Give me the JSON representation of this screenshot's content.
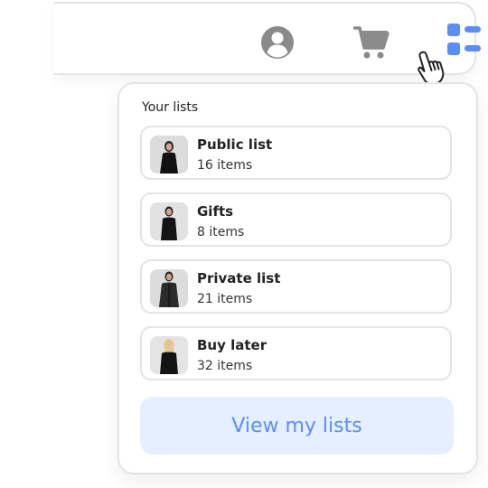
{
  "header": {
    "icons": [
      "profile-icon",
      "cart-icon",
      "lists-icon"
    ]
  },
  "panel": {
    "title": "Your lists",
    "lists": [
      {
        "name": "Public list",
        "count": "16 items"
      },
      {
        "name": "Gifts",
        "count": "8 items"
      },
      {
        "name": "Private list",
        "count": "21 items"
      },
      {
        "name": "Buy later",
        "count": "32 items"
      }
    ],
    "button_label": "View my lists"
  },
  "colors": {
    "accent": "#5b8ef2",
    "button_bg": "#e6efff",
    "icon_gray": "#8a8a8a",
    "border": "#e4e4e4"
  }
}
